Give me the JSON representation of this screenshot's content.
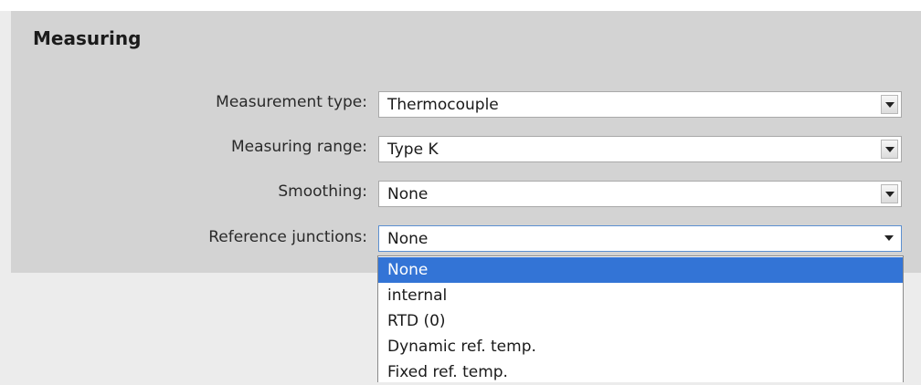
{
  "section": {
    "title": "Measuring"
  },
  "rows": [
    {
      "label": "Measurement type:",
      "value": "Thermocouple"
    },
    {
      "label": "Measuring range:",
      "value": "Type K"
    },
    {
      "label": "Smoothing:",
      "value": "None"
    },
    {
      "label": "Reference junctions:",
      "value": "None"
    }
  ],
  "dropdown": {
    "options": [
      "None",
      "internal",
      "RTD (0)",
      "Dynamic ref. temp.",
      "Fixed ref. temp."
    ],
    "selected_index": 0
  },
  "icons": {
    "dropdown_arrow": "chevron-down-icon"
  },
  "colors": {
    "panel": "#d3d3d3",
    "selection": "#3374d6",
    "focus_border": "#5b8fd1"
  }
}
